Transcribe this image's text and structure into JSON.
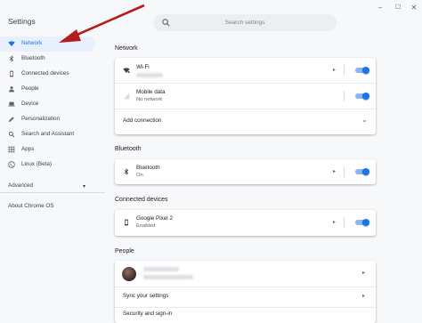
{
  "app_title": "Settings",
  "search": {
    "placeholder": "Search settings"
  },
  "window_controls": {
    "minimize": "–",
    "maximize": "☐",
    "close": "✕"
  },
  "sidebar": {
    "items": [
      {
        "label": "Network",
        "icon": "wifi-icon",
        "active": true
      },
      {
        "label": "Bluetooth",
        "icon": "bluetooth-icon"
      },
      {
        "label": "Connected devices",
        "icon": "phone-icon"
      },
      {
        "label": "People",
        "icon": "person-icon"
      },
      {
        "label": "Device",
        "icon": "laptop-icon"
      },
      {
        "label": "Personalization",
        "icon": "pen-icon"
      },
      {
        "label": "Search and Assistant",
        "icon": "search-icon"
      },
      {
        "label": "Apps",
        "icon": "apps-grid-icon"
      },
      {
        "label": "Linux (Beta)",
        "icon": "linux-terminal-icon"
      }
    ],
    "advanced": "Advanced",
    "advanced_caret": "▾",
    "about": "About Chrome OS"
  },
  "sections": {
    "network": {
      "title": "Network",
      "wifi_label": "Wi-Fi",
      "mobile_label": "Mobile data",
      "mobile_status": "No network",
      "add_connection": "Add connection"
    },
    "bluetooth": {
      "title": "Bluetooth",
      "label": "Bluetooth",
      "status": "On"
    },
    "connected_devices": {
      "title": "Connected devices",
      "label": "Google Pixel 2",
      "status": "Enabled"
    },
    "people": {
      "title": "People",
      "sync_label": "Sync your settings",
      "security_label": "Security and sign-in"
    }
  },
  "glyphs": {
    "arrow": "▸",
    "caret_down": "⌄"
  },
  "toggles": {
    "wifi": true,
    "mobile": true,
    "bluetooth": true,
    "pixel": true
  },
  "colors": {
    "accent": "#1a73e8",
    "annotation_arrow": "#b71c1c"
  }
}
